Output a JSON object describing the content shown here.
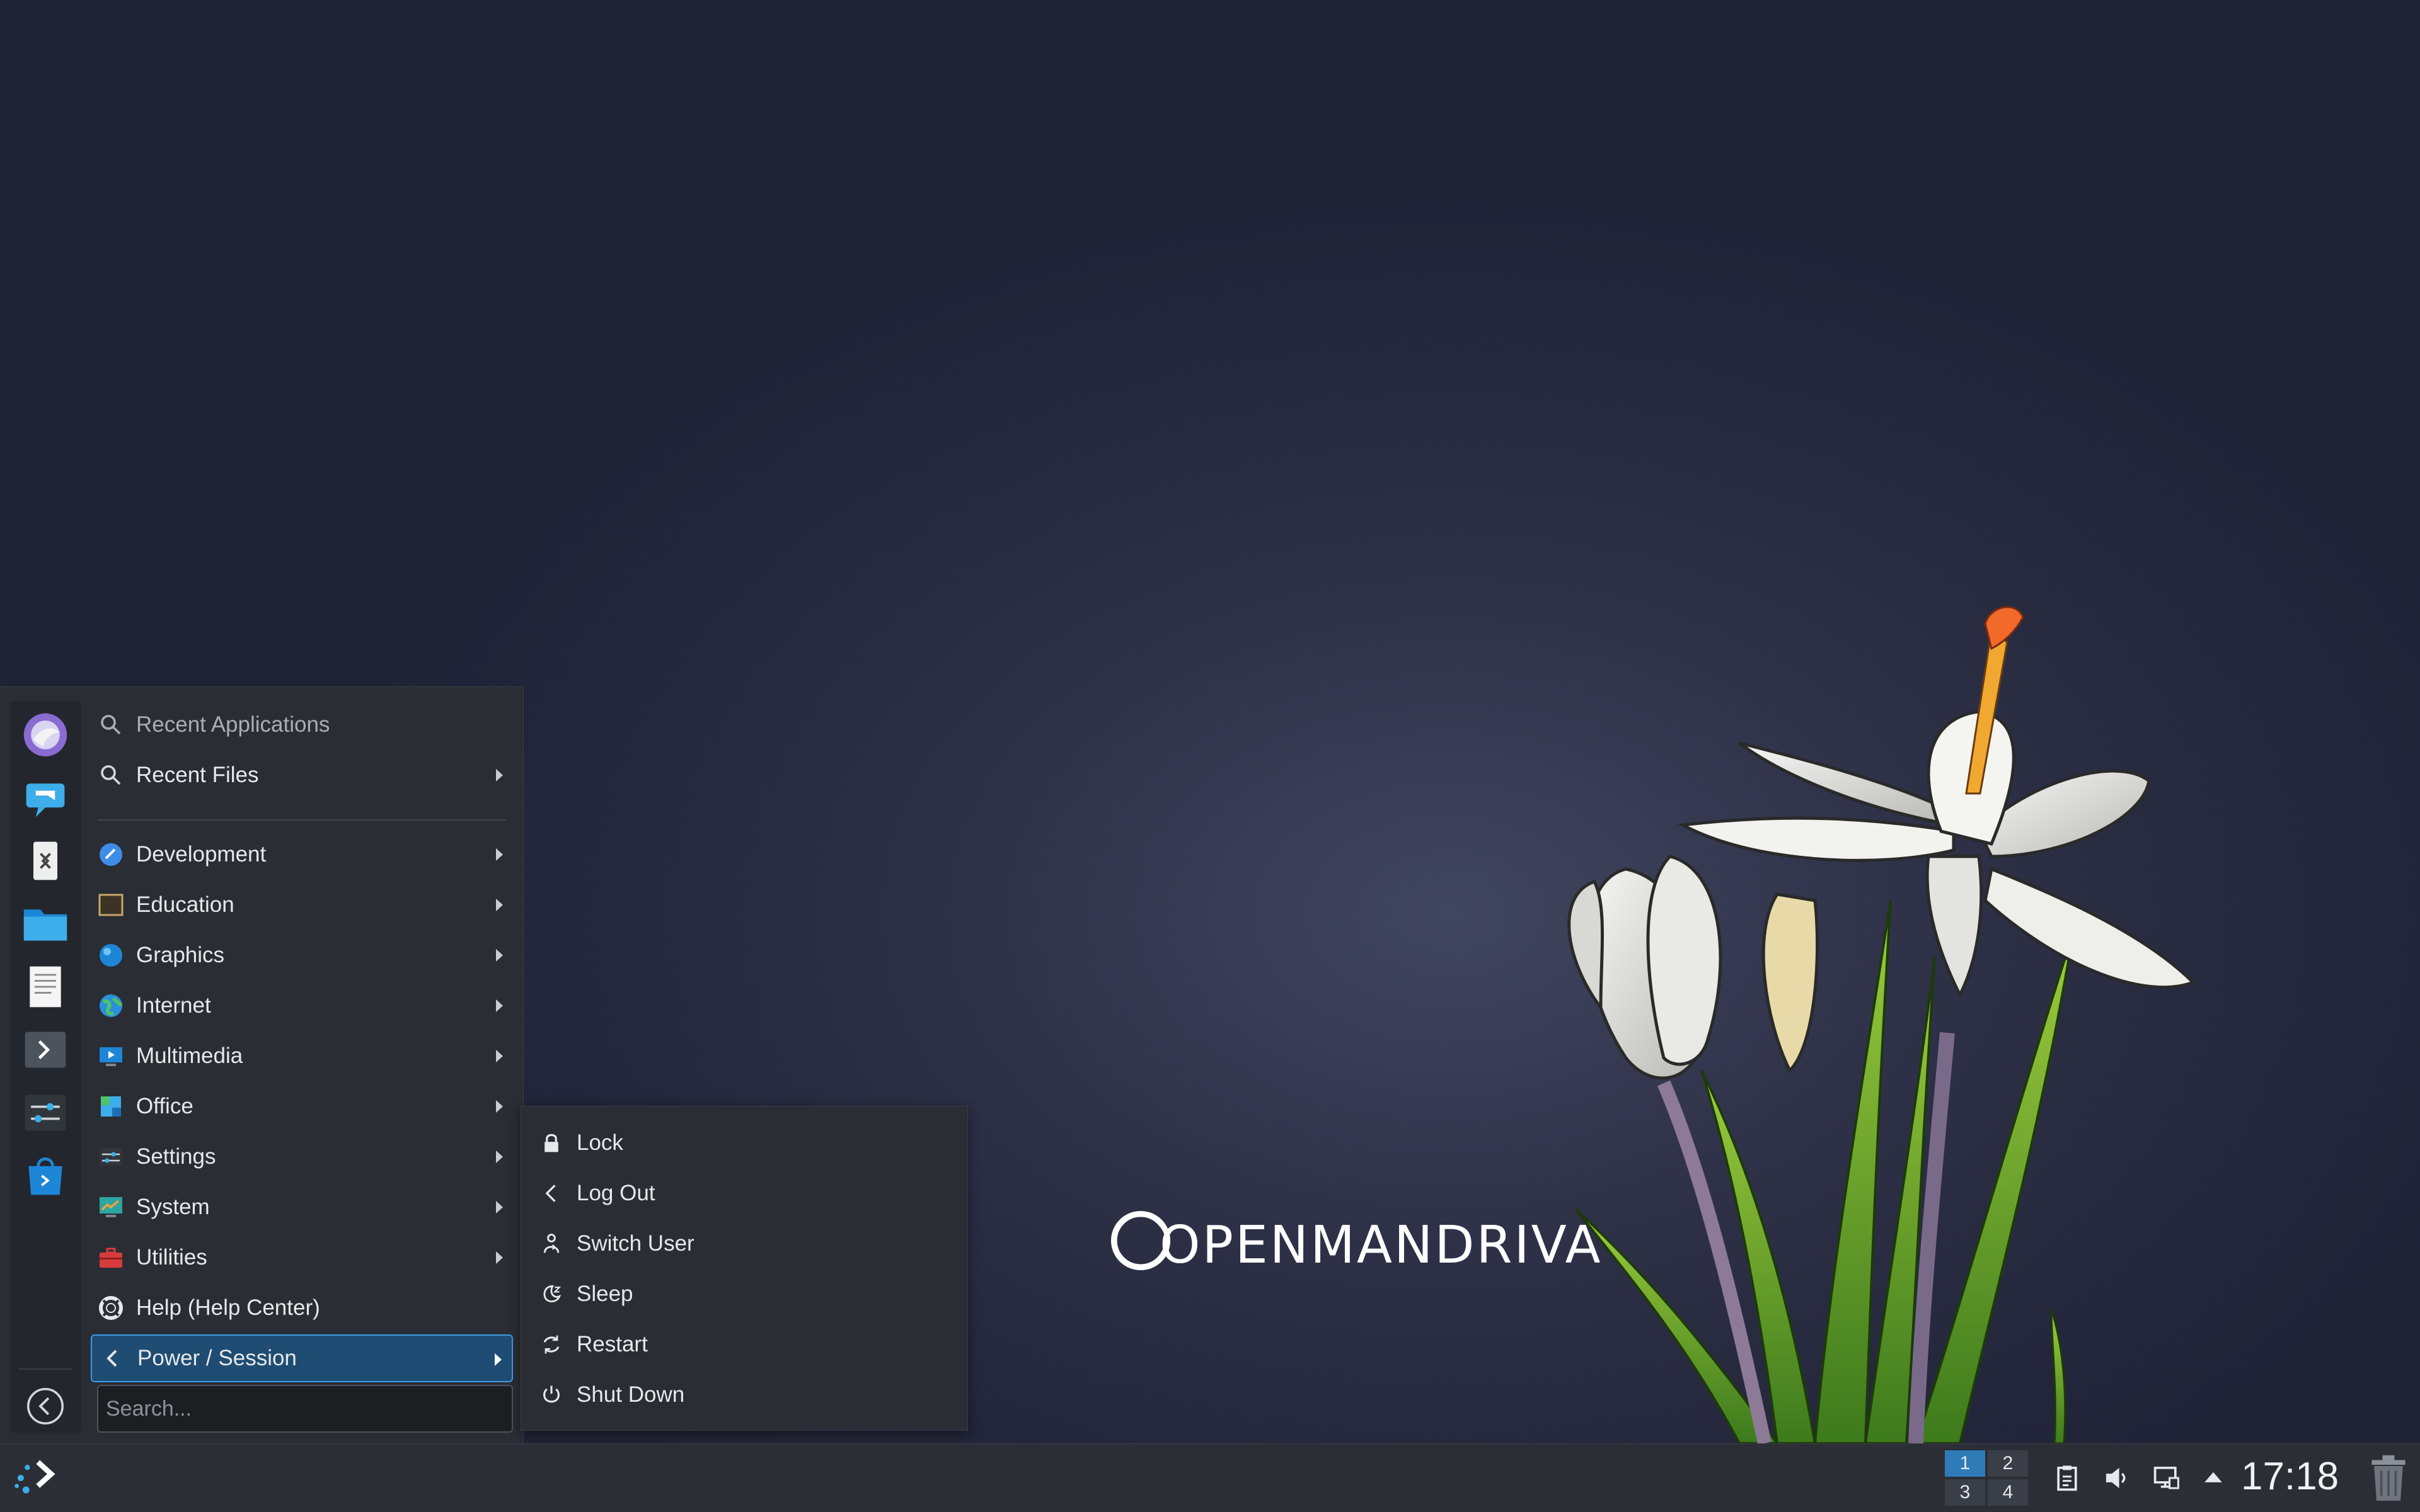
{
  "wallpaper": {
    "logo_text": "OPENMANDRIVA"
  },
  "launcher": {
    "favorites": [
      "thunderbird-icon",
      "konversation-icon",
      "kde-connect-icon",
      "file-manager-icon",
      "text-editor-icon",
      "terminal-icon",
      "system-settings-icon",
      "discover-icon"
    ],
    "items": [
      {
        "label": "Recent Applications",
        "icon": "search-icon",
        "has_submenu": false,
        "dim": true
      },
      {
        "label": "Recent Files",
        "icon": "search-icon",
        "has_submenu": true
      },
      {
        "label": "Development",
        "icon": "development-icon",
        "has_submenu": true
      },
      {
        "label": "Education",
        "icon": "education-icon",
        "has_submenu": true
      },
      {
        "label": "Graphics",
        "icon": "graphics-icon",
        "has_submenu": true
      },
      {
        "label": "Internet",
        "icon": "internet-icon",
        "has_submenu": true
      },
      {
        "label": "Multimedia",
        "icon": "multimedia-icon",
        "has_submenu": true
      },
      {
        "label": "Office",
        "icon": "office-icon",
        "has_submenu": true
      },
      {
        "label": "Settings",
        "icon": "settings-icon",
        "has_submenu": true
      },
      {
        "label": "System",
        "icon": "system-icon",
        "has_submenu": true
      },
      {
        "label": "Utilities",
        "icon": "utilities-icon",
        "has_submenu": true
      },
      {
        "label": "Help (Help Center)",
        "icon": "help-icon",
        "has_submenu": false
      },
      {
        "label": "Power / Session",
        "icon": "chevron-left-icon",
        "has_submenu": true,
        "active": true
      }
    ],
    "search_placeholder": "Search..."
  },
  "power_submenu": {
    "items": [
      {
        "label": "Lock",
        "icon": "lock-icon"
      },
      {
        "label": "Log Out",
        "icon": "logout-icon"
      },
      {
        "label": "Switch User",
        "icon": "switch-user-icon"
      },
      {
        "label": "Sleep",
        "icon": "sleep-icon"
      },
      {
        "label": "Restart",
        "icon": "restart-icon"
      },
      {
        "label": "Shut Down",
        "icon": "shutdown-icon"
      }
    ]
  },
  "taskbar": {
    "pager": {
      "desktops": [
        "1",
        "2",
        "3",
        "4"
      ],
      "current": "1"
    },
    "tray_icons": [
      "clipboard-icon",
      "volume-icon",
      "network-icon",
      "expand-tray-icon"
    ],
    "clock": "17:18"
  },
  "colors": {
    "accent": "#3d9ae8",
    "active_bg": "#1f4c72",
    "panel_bg": "#2a2d34",
    "taskbar_bg": "#2b2e35"
  }
}
